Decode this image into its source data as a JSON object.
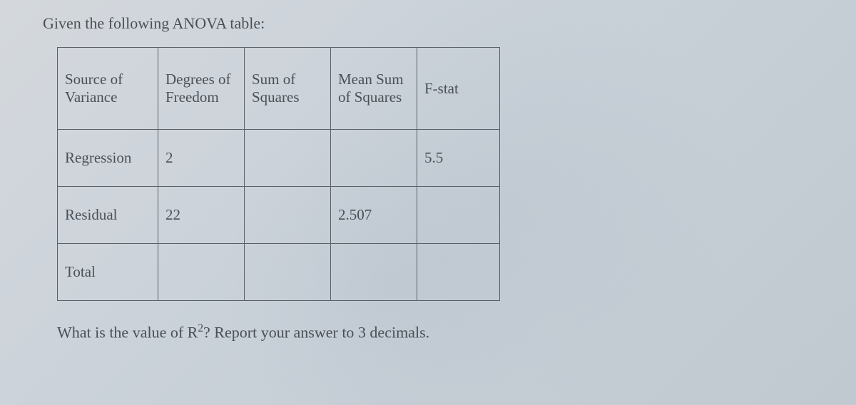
{
  "heading": "Given the following ANOVA table:",
  "columns": {
    "source": "Source of Variance",
    "dof": "Degrees of Freedom",
    "ss": "Sum of Squares",
    "mss": "Mean Sum of Squares",
    "fstat": "F-stat"
  },
  "rows": {
    "regression": {
      "label": "Regression",
      "dof": "2",
      "ss": "",
      "mss": "",
      "fstat": "5.5"
    },
    "residual": {
      "label": "Residual",
      "dof": "22",
      "ss": "",
      "mss": "2.507",
      "fstat": ""
    },
    "total": {
      "label": "Total",
      "dof": "",
      "ss": "",
      "mss": "",
      "fstat": ""
    }
  },
  "question_prefix": "What is the value of R",
  "question_exponent": "2",
  "question_suffix": "? Report your answer to 3 decimals."
}
